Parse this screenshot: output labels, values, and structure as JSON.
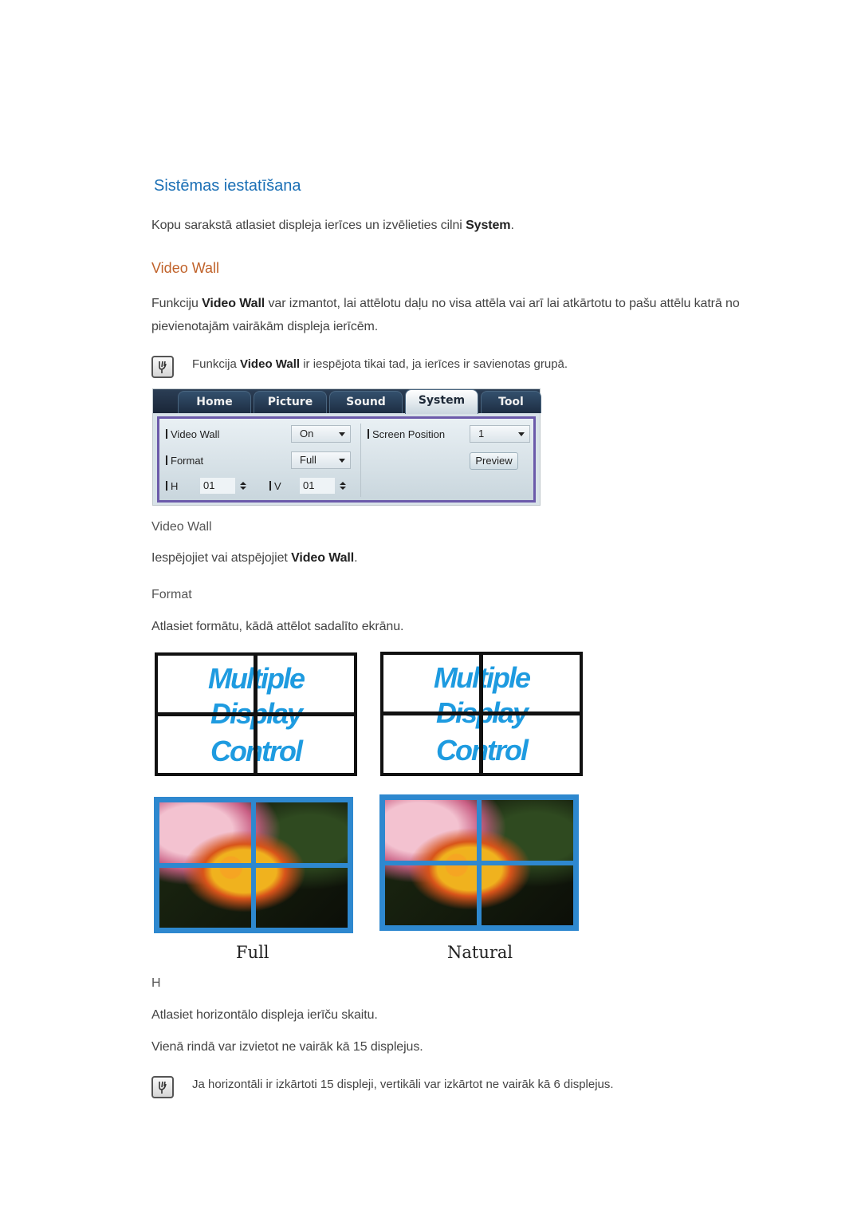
{
  "section_title": "Sistēmas iestatīšana",
  "intro": {
    "before": "Kopu sarakstā atlasiet displeja ierīces un izvēlieties cilni ",
    "bold": "System",
    "after": "."
  },
  "video_wall_heading": "Video Wall",
  "description": {
    "line1_before": "Funkciju ",
    "line1_bold": "Video Wall",
    "line1_after": " var izmantot, lai attēlotu daļu no visa attēla vai arī lai atkārtotu to pašu attēlu katrā no",
    "line2": "pievienotajām vairākām displeja ierīcēm."
  },
  "note1": {
    "icon": "note-icon",
    "before": "Funkcija ",
    "bold": "Video Wall",
    "after": " ir iespējota tikai tad, ja ierīces ir savienotas grupā."
  },
  "ui_panel": {
    "tabs": [
      {
        "label": "Home",
        "active": false
      },
      {
        "label": "Picture",
        "active": false
      },
      {
        "label": "Sound",
        "active": false
      },
      {
        "label": "System",
        "active": true
      },
      {
        "label": "Tool",
        "active": false
      }
    ],
    "video_wall": {
      "label": "Video Wall",
      "value": "On"
    },
    "format": {
      "label": "Format",
      "value": "Full"
    },
    "h": {
      "label": "H",
      "value": "01"
    },
    "v": {
      "label": "V",
      "value": "01"
    },
    "screen_position": {
      "label": "Screen Position",
      "value": "1"
    },
    "preview_button": "Preview"
  },
  "video_wall_sub": {
    "heading": "Video Wall",
    "text_before": "Iespējojiet vai atspējojiet ",
    "text_bold": "Video Wall",
    "text_after": "."
  },
  "format_sub": {
    "heading": "Format",
    "text": "Atlasiet formātu, kādā attēlot sadalīto ekrānu."
  },
  "illustrations": {
    "logo_lines": [
      "Multiple",
      "Display",
      "Control"
    ],
    "captions": [
      "Full",
      "Natural"
    ]
  },
  "h_sub": {
    "heading": "H",
    "text1": "Atlasiet horizontālo displeja ierīču skaitu.",
    "text2": "Vienā rindā var izvietot ne vairāk kā 15 displejus."
  },
  "note2": {
    "icon": "note-icon",
    "text": "Ja horizontāli ir izkārtoti 15 displeji, vertikāli var izkārtot ne vairāk kā 6 displejus."
  }
}
